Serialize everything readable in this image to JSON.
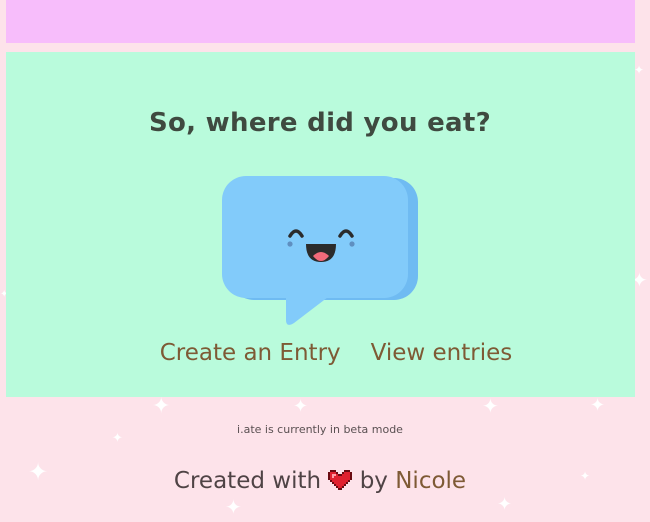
{
  "header_band": {
    "color": "#f7bdfb"
  },
  "main": {
    "background": "#b9fbdc",
    "title": "So, where did you eat?",
    "mascot": "smiling-chat-bubble-icon",
    "links": {
      "create_entry": "Create an Entry",
      "view_entries": "View entries"
    }
  },
  "footer": {
    "beta_notice": "i.ate is currently in beta mode",
    "credit_prefix": "Created with",
    "credit_icon": "heart-icon",
    "credit_by": "by",
    "credit_author": "Nicole"
  }
}
